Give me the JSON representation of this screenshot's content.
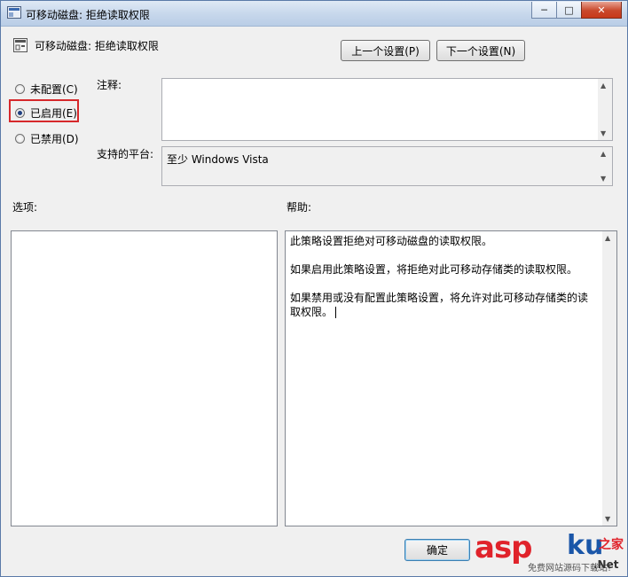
{
  "window": {
    "title": "可移动磁盘: 拒绝读取权限",
    "minimize": "─",
    "maximize": "□",
    "close": "✕"
  },
  "header": {
    "title": "可移动磁盘: 拒绝读取权限",
    "prev_label": "上一个设置(P)",
    "next_label": "下一个设置(N)"
  },
  "radio_options": [
    {
      "label": "未配置(C)",
      "checked": false
    },
    {
      "label": "已启用(E)",
      "checked": true
    },
    {
      "label": "已禁用(D)",
      "checked": false
    }
  ],
  "comment": {
    "label": "注释:",
    "value": ""
  },
  "platform": {
    "label": "支持的平台:",
    "value": "至少 Windows Vista"
  },
  "options": {
    "label": "选项:"
  },
  "help": {
    "label": "帮助:",
    "paragraphs": [
      "此策略设置拒绝对可移动磁盘的读取权限。",
      "如果启用此策略设置，将拒绝对此可移动存储类的读取权限。",
      "如果禁用或没有配置此策略设置，将允许对此可移动存储类的读取权限。"
    ]
  },
  "footer": {
    "ok_label": "确定"
  },
  "watermark": {
    "brand_a": "asp",
    "brand_b": "ku",
    "suffix": "之家",
    "sub": "免费网站源码下载站!",
    "net": ".Net"
  },
  "colors": {
    "highlight": "#d6282b",
    "titlebar": "#c8d8ec",
    "close": "#c8391a"
  }
}
